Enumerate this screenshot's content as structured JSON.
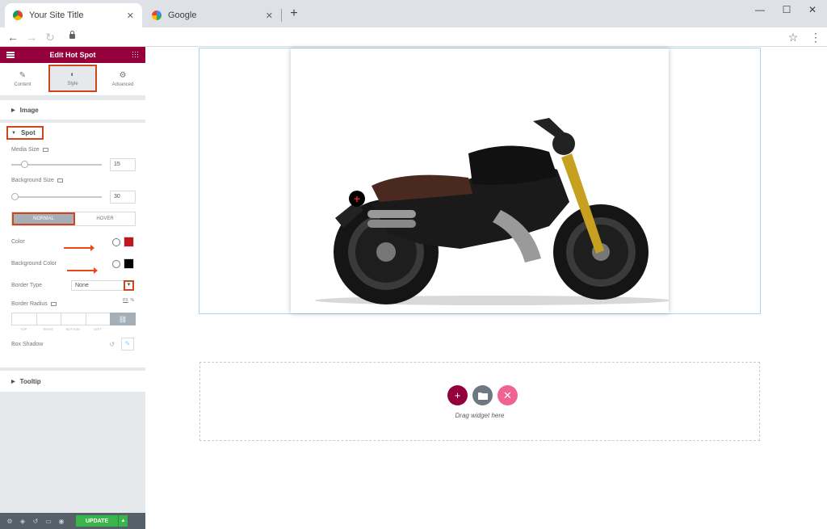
{
  "browser": {
    "tabs": [
      {
        "title": "Your Site Title",
        "active": true
      },
      {
        "title": "Google",
        "active": false
      }
    ],
    "new_tab": "+",
    "tab_close": "✕",
    "controls": {
      "minimize": "—",
      "maximize": "☐",
      "close": "✕"
    },
    "nav": {
      "back": "←",
      "forward": "→",
      "reload": "↻",
      "star": "☆",
      "menu": "⋮"
    }
  },
  "panel": {
    "title": "Edit Hot Spot",
    "tabs": [
      {
        "label": "Content",
        "icon": "pencil-icon",
        "glyph": "✎",
        "selected": false
      },
      {
        "label": "Style",
        "icon": "half-circle-icon",
        "glyph": "◐",
        "selected": true
      },
      {
        "label": "Advanced",
        "icon": "gear-icon",
        "glyph": "⚙",
        "selected": false
      }
    ],
    "sections": {
      "image": "Image",
      "spot": "Spot",
      "tooltip": "Tooltip"
    },
    "media_size": {
      "label": "Media Size",
      "value": "15",
      "level": 0.15
    },
    "background_size": {
      "label": "Background Size",
      "value": "30",
      "level": 0.04
    },
    "state_tabs": {
      "normal": "NORMAL",
      "hover": "HOVER"
    },
    "color": {
      "label": "Color",
      "value": "#c0161c"
    },
    "background_color": {
      "label": "Background Color",
      "value": "#000000"
    },
    "border_type": {
      "label": "Border Type",
      "value": "None"
    },
    "border_radius": {
      "label": "Border Radius",
      "unit": "PX",
      "unit_alt": "%",
      "dims": [
        "TOP",
        "RIGHT",
        "BOTTOM",
        "LEFT"
      ]
    },
    "box_shadow": {
      "label": "Box Shadow"
    },
    "bottom": {
      "update": "UPDATE"
    }
  },
  "canvas": {
    "hotspot_glyph": "+",
    "drag_text": "Drag widget here",
    "add_buttons": [
      {
        "icon": "plus-icon",
        "glyph": "+",
        "color": "#93003c"
      },
      {
        "icon": "folder-icon",
        "glyph": "▬",
        "color": "#6d7882"
      },
      {
        "icon": "template-icon",
        "glyph": "✕",
        "color": "#f06292"
      }
    ]
  }
}
